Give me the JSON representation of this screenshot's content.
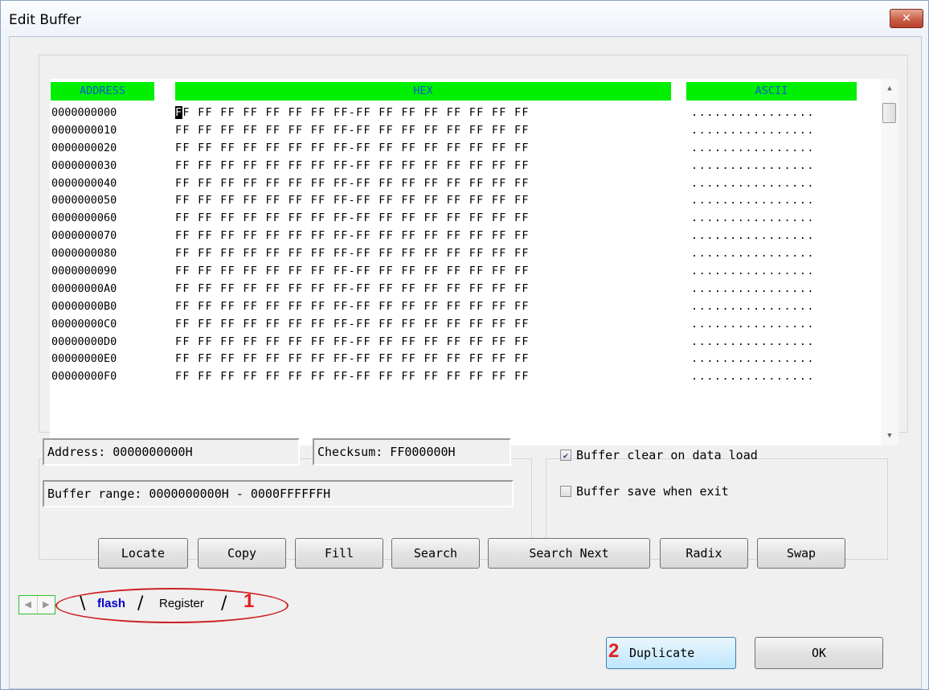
{
  "window": {
    "title": "Edit Buffer",
    "close_icon": "close-icon"
  },
  "hexview": {
    "headers": {
      "address": "ADDRESS",
      "hex": "HEX",
      "ascii": "ASCII"
    },
    "header_color": "#00f000",
    "cursor_byte": "F",
    "rows": [
      {
        "address": "0000000000",
        "hex": "FF FF FF FF FF FF FF FF-FF FF FF FF FF FF FF FF",
        "ascii": "................"
      },
      {
        "address": "0000000010",
        "hex": "FF FF FF FF FF FF FF FF-FF FF FF FF FF FF FF FF",
        "ascii": "................"
      },
      {
        "address": "0000000020",
        "hex": "FF FF FF FF FF FF FF FF-FF FF FF FF FF FF FF FF",
        "ascii": "................"
      },
      {
        "address": "0000000030",
        "hex": "FF FF FF FF FF FF FF FF-FF FF FF FF FF FF FF FF",
        "ascii": "................"
      },
      {
        "address": "0000000040",
        "hex": "FF FF FF FF FF FF FF FF-FF FF FF FF FF FF FF FF",
        "ascii": "................"
      },
      {
        "address": "0000000050",
        "hex": "FF FF FF FF FF FF FF FF-FF FF FF FF FF FF FF FF",
        "ascii": "................"
      },
      {
        "address": "0000000060",
        "hex": "FF FF FF FF FF FF FF FF-FF FF FF FF FF FF FF FF",
        "ascii": "................"
      },
      {
        "address": "0000000070",
        "hex": "FF FF FF FF FF FF FF FF-FF FF FF FF FF FF FF FF",
        "ascii": "................"
      },
      {
        "address": "0000000080",
        "hex": "FF FF FF FF FF FF FF FF-FF FF FF FF FF FF FF FF",
        "ascii": "................"
      },
      {
        "address": "0000000090",
        "hex": "FF FF FF FF FF FF FF FF-FF FF FF FF FF FF FF FF",
        "ascii": "................"
      },
      {
        "address": "00000000A0",
        "hex": "FF FF FF FF FF FF FF FF-FF FF FF FF FF FF FF FF",
        "ascii": "................"
      },
      {
        "address": "00000000B0",
        "hex": "FF FF FF FF FF FF FF FF-FF FF FF FF FF FF FF FF",
        "ascii": "................"
      },
      {
        "address": "00000000C0",
        "hex": "FF FF FF FF FF FF FF FF-FF FF FF FF FF FF FF FF",
        "ascii": "................"
      },
      {
        "address": "00000000D0",
        "hex": "FF FF FF FF FF FF FF FF-FF FF FF FF FF FF FF FF",
        "ascii": "................"
      },
      {
        "address": "00000000E0",
        "hex": "FF FF FF FF FF FF FF FF-FF FF FF FF FF FF FF FF",
        "ascii": "................"
      },
      {
        "address": "00000000F0",
        "hex": "FF FF FF FF FF FF FF FF-FF FF FF FF FF FF FF FF",
        "ascii": "................"
      }
    ]
  },
  "info": {
    "address": "Address: 0000000000H",
    "checksum": "Checksum: FF000000H",
    "buffer_range": "Buffer range: 0000000000H - 0000FFFFFFH"
  },
  "options": [
    {
      "label": "Buffer clear on data load",
      "checked": true
    },
    {
      "label": "Buffer save when exit",
      "checked": false
    }
  ],
  "toolbar": {
    "buttons": [
      "Locate",
      "Copy",
      "Fill",
      "Search",
      "Search Next",
      "Radix",
      "Swap"
    ]
  },
  "tabs": {
    "items": [
      "flash",
      "Register"
    ],
    "active": "flash",
    "annotation": "1"
  },
  "footer": {
    "duplicate_label": "Duplicate",
    "duplicate_annotation": "2",
    "ok_label": "OK"
  },
  "colors": {
    "annotation": "#cc2020",
    "active_tab": "#0000cc"
  }
}
